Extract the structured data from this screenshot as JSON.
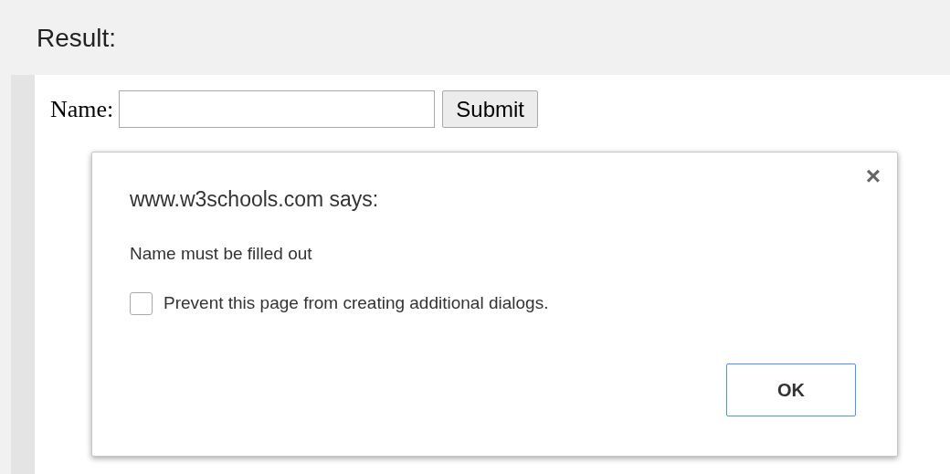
{
  "header": {
    "title": "Result:"
  },
  "form": {
    "label": "Name:",
    "submit": "Submit"
  },
  "dialog": {
    "title": "www.w3schools.com says:",
    "close": "×",
    "message": "Name must be filled out",
    "prevent": {
      "label": "Prevent this page from creating additional dialogs.",
      "checked": false
    },
    "ok": "OK"
  }
}
